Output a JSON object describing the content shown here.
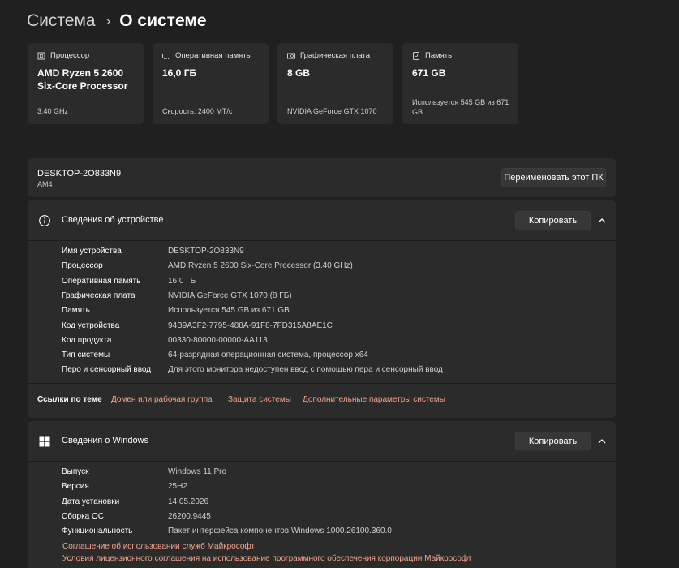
{
  "breadcrumb": {
    "parent": "Система",
    "separator": "›",
    "current": "О системе"
  },
  "cards": [
    {
      "label": "Процессор",
      "icon": "processor-icon",
      "value": "AMD Ryzen 5 2600 Six-Core Processor",
      "sub": "3.40 GHz"
    },
    {
      "label": "Оперативная память",
      "icon": "ram-icon",
      "value": "16,0 ГБ",
      "sub": "Скорость: 2400 МТ/с"
    },
    {
      "label": "Графическая плата",
      "icon": "gpu-icon",
      "value": "8 GB",
      "sub": "NVIDIA GeForce GTX 1070"
    },
    {
      "label": "Память",
      "icon": "storage-icon",
      "value": "671 GB",
      "sub": "Используется 545 GB из 671 GB"
    }
  ],
  "pc": {
    "name": "DESKTOP-2O833N9",
    "model": "AM4",
    "rename_label": "Переименовать этот ПК"
  },
  "device_specs": {
    "title": "Сведения об устройстве",
    "copy_label": "Копировать",
    "rows": [
      {
        "key": "Имя устройства",
        "value": "DESKTOP-2O833N9"
      },
      {
        "key": "Процессор",
        "value": "AMD Ryzen 5 2600 Six-Core Processor (3.40 GHz)"
      },
      {
        "key": "Оперативная память",
        "value": "16,0 ГБ"
      },
      {
        "key": "Графическая плата",
        "value": "NVIDIA GeForce GTX 1070 (8 ГБ)"
      },
      {
        "key": "Память",
        "value": "Используется 545 GB из 671 GB"
      },
      {
        "key": "Код устройства",
        "value": "94B9A3F2-7795-488A-91F8-7FD315A8AE1C"
      },
      {
        "key": "Код продукта",
        "value": "00330-80000-00000-AA113"
      },
      {
        "key": "Тип системы",
        "value": "64-разрядная операционная система, процессор x64"
      },
      {
        "key": "Перо и сенсорный ввод",
        "value": "Для этого монитора недоступен ввод с помощью пера и сенсорный ввод"
      }
    ]
  },
  "related_links": {
    "label": "Ссылки по теме",
    "links": [
      "Домен или рабочая группа",
      "Защита системы",
      "Дополнительные параметры системы"
    ]
  },
  "windows_specs": {
    "title": "Сведения о Windows",
    "copy_label": "Копировать",
    "rows": [
      {
        "key": "Выпуск",
        "value": "Windows 11 Pro"
      },
      {
        "key": "Версия",
        "value": "25H2"
      },
      {
        "key": "Дата установки",
        "value": "14.05.2026"
      },
      {
        "key": "Сборка ОС",
        "value": "26200.9445"
      },
      {
        "key": "Функциональность",
        "value": "Пакет интерфейса компонентов Windows 1000.26100.360.0"
      }
    ],
    "links": [
      "Соглашение об использовании служб Майкрософт",
      "Условия лицензионного соглашения на использование программного обеспечения корпорации Майкрософт"
    ]
  },
  "colors": {
    "background": "#202020",
    "card": "#2b2b2b",
    "link": "#f4a58e"
  }
}
